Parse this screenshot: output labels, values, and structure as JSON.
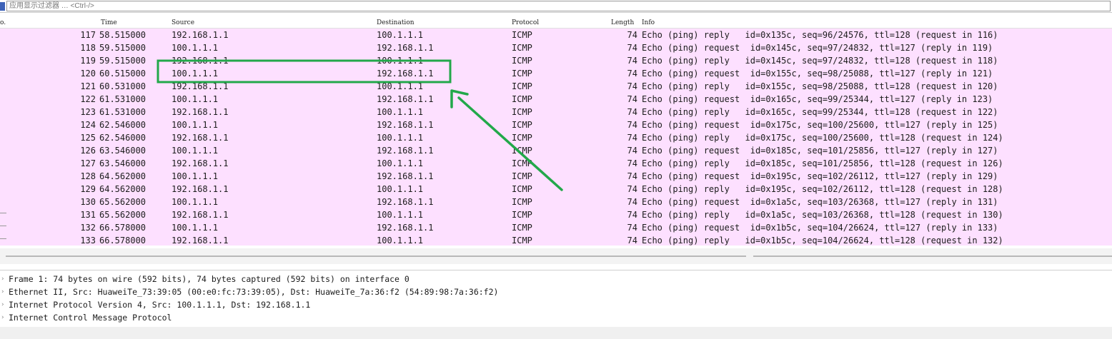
{
  "filter": {
    "placeholder": "应用显示过滤器 … <Ctrl-/>"
  },
  "columns": [
    "o.",
    "Time",
    "Source",
    "Destination",
    "Protocol",
    "Length",
    "Info"
  ],
  "packets": [
    {
      "no": "117",
      "time": "58.515000",
      "src": "192.168.1.1",
      "dst": "100.1.1.1",
      "proto": "ICMP",
      "len": "74",
      "info": "Echo (ping) reply   id=0x135c, seq=96/24576, ttl=128 (request in 116)"
    },
    {
      "no": "118",
      "time": "59.515000",
      "src": "100.1.1.1",
      "dst": "192.168.1.1",
      "proto": "ICMP",
      "len": "74",
      "info": "Echo (ping) request  id=0x145c, seq=97/24832, ttl=127 (reply in 119)"
    },
    {
      "no": "119",
      "time": "59.515000",
      "src": "192.168.1.1",
      "dst": "100.1.1.1",
      "proto": "ICMP",
      "len": "74",
      "info": "Echo (ping) reply   id=0x145c, seq=97/24832, ttl=128 (request in 118)"
    },
    {
      "no": "120",
      "time": "60.515000",
      "src": "100.1.1.1",
      "dst": "192.168.1.1",
      "proto": "ICMP",
      "len": "74",
      "info": "Echo (ping) request  id=0x155c, seq=98/25088, ttl=127 (reply in 121)"
    },
    {
      "no": "121",
      "time": "60.531000",
      "src": "192.168.1.1",
      "dst": "100.1.1.1",
      "proto": "ICMP",
      "len": "74",
      "info": "Echo (ping) reply   id=0x155c, seq=98/25088, ttl=128 (request in 120)"
    },
    {
      "no": "122",
      "time": "61.531000",
      "src": "100.1.1.1",
      "dst": "192.168.1.1",
      "proto": "ICMP",
      "len": "74",
      "info": "Echo (ping) request  id=0x165c, seq=99/25344, ttl=127 (reply in 123)"
    },
    {
      "no": "123",
      "time": "61.531000",
      "src": "192.168.1.1",
      "dst": "100.1.1.1",
      "proto": "ICMP",
      "len": "74",
      "info": "Echo (ping) reply   id=0x165c, seq=99/25344, ttl=128 (request in 122)"
    },
    {
      "no": "124",
      "time": "62.546000",
      "src": "100.1.1.1",
      "dst": "192.168.1.1",
      "proto": "ICMP",
      "len": "74",
      "info": "Echo (ping) request  id=0x175c, seq=100/25600, ttl=127 (reply in 125)"
    },
    {
      "no": "125",
      "time": "62.546000",
      "src": "192.168.1.1",
      "dst": "100.1.1.1",
      "proto": "ICMP",
      "len": "74",
      "info": "Echo (ping) reply   id=0x175c, seq=100/25600, ttl=128 (request in 124)"
    },
    {
      "no": "126",
      "time": "63.546000",
      "src": "100.1.1.1",
      "dst": "192.168.1.1",
      "proto": "ICMP",
      "len": "74",
      "info": "Echo (ping) request  id=0x185c, seq=101/25856, ttl=127 (reply in 127)"
    },
    {
      "no": "127",
      "time": "63.546000",
      "src": "192.168.1.1",
      "dst": "100.1.1.1",
      "proto": "ICMP",
      "len": "74",
      "info": "Echo (ping) reply   id=0x185c, seq=101/25856, ttl=128 (request in 126)"
    },
    {
      "no": "128",
      "time": "64.562000",
      "src": "100.1.1.1",
      "dst": "192.168.1.1",
      "proto": "ICMP",
      "len": "74",
      "info": "Echo (ping) request  id=0x195c, seq=102/26112, ttl=127 (reply in 129)"
    },
    {
      "no": "129",
      "time": "64.562000",
      "src": "192.168.1.1",
      "dst": "100.1.1.1",
      "proto": "ICMP",
      "len": "74",
      "info": "Echo (ping) reply   id=0x195c, seq=102/26112, ttl=128 (request in 128)"
    },
    {
      "no": "130",
      "time": "65.562000",
      "src": "100.1.1.1",
      "dst": "192.168.1.1",
      "proto": "ICMP",
      "len": "74",
      "info": "Echo (ping) request  id=0x1a5c, seq=103/26368, ttl=127 (reply in 131)"
    },
    {
      "no": "131",
      "time": "65.562000",
      "src": "192.168.1.1",
      "dst": "100.1.1.1",
      "proto": "ICMP",
      "len": "74",
      "info": "Echo (ping) reply   id=0x1a5c, seq=103/26368, ttl=128 (request in 130)"
    },
    {
      "no": "132",
      "time": "66.578000",
      "src": "100.1.1.1",
      "dst": "192.168.1.1",
      "proto": "ICMP",
      "len": "74",
      "info": "Echo (ping) request  id=0x1b5c, seq=104/26624, ttl=127 (reply in 133)"
    },
    {
      "no": "133",
      "time": "66.578000",
      "src": "192.168.1.1",
      "dst": "100.1.1.1",
      "proto": "ICMP",
      "len": "74",
      "info": "Echo (ping) reply   id=0x1b5c, seq=104/26624, ttl=128 (request in 132)"
    }
  ],
  "details": [
    "Frame 1: 74 bytes on wire (592 bits), 74 bytes captured (592 bits) on interface 0",
    "Ethernet II, Src: HuaweiTe_73:39:05 (00:e0:fc:73:39:05), Dst: HuaweiTe_7a:36:f2 (54:89:98:7a:36:f2)",
    "Internet Protocol Version 4, Src: 100.1.1.1, Dst: 192.168.1.1",
    "Internet Control Message Protocol"
  ],
  "detail_arrow_glyph": "›",
  "colors": {
    "row_bg": "#fde0ff",
    "annotation": "#22a84a"
  }
}
